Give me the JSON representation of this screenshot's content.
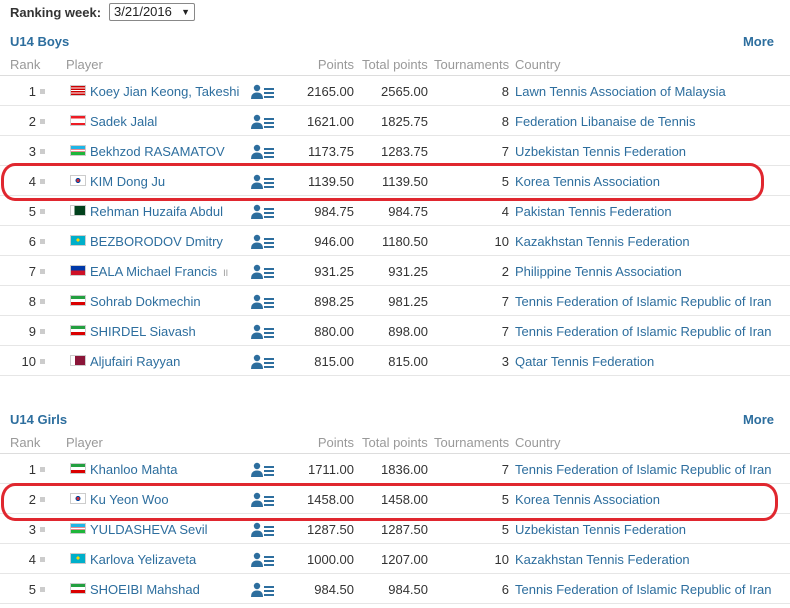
{
  "filter": {
    "label": "Ranking week:",
    "selected": "3/21/2016"
  },
  "headers": {
    "rank": "Rank",
    "player": "Player",
    "points": "Points",
    "total": "Total points",
    "tournaments": "Tournaments",
    "country": "Country"
  },
  "boys": {
    "title": "U14 Boys",
    "more": "More",
    "rows": [
      {
        "rank": "1",
        "flag": "malaysia",
        "player": "Koey Jian Keong, Takeshi",
        "points": "2165.00",
        "total": "2565.00",
        "tournaments": "8",
        "country": "Lawn Tennis Association of Malaysia"
      },
      {
        "rank": "2",
        "flag": "lebanon",
        "player": "Sadek Jalal",
        "points": "1621.00",
        "total": "1825.75",
        "tournaments": "8",
        "country": "Federation Libanaise de Tennis"
      },
      {
        "rank": "3",
        "flag": "uzbekistan",
        "player": "Bekhzod RASAMATOV",
        "points": "1173.75",
        "total": "1283.75",
        "tournaments": "7",
        "country": "Uzbekistan Tennis Federation"
      },
      {
        "rank": "4",
        "flag": "korea",
        "player": "KIM Dong Ju",
        "points": "1139.50",
        "total": "1139.50",
        "tournaments": "5",
        "country": "Korea Tennis Association"
      },
      {
        "rank": "5",
        "flag": "pakistan",
        "player": "Rehman Huzaifa Abdul",
        "points": "984.75",
        "total": "984.75",
        "tournaments": "4",
        "country": "Pakistan Tennis Federation"
      },
      {
        "rank": "6",
        "flag": "kazakhstan",
        "player": "BEZBORODOV Dmitry",
        "points": "946.00",
        "total": "1180.50",
        "tournaments": "10",
        "country": "Kazakhstan Tennis Federation"
      },
      {
        "rank": "7",
        "flag": "philippines",
        "player": "EALA Michael Francis",
        "suffix": "II",
        "points": "931.25",
        "total": "931.25",
        "tournaments": "2",
        "country": "Philippine Tennis Association"
      },
      {
        "rank": "8",
        "flag": "iran",
        "player": "Sohrab Dokmechin",
        "points": "898.25",
        "total": "981.25",
        "tournaments": "7",
        "country": "Tennis Federation of Islamic Republic of Iran"
      },
      {
        "rank": "9",
        "flag": "iran",
        "player": "SHIRDEL Siavash",
        "points": "880.00",
        "total": "898.00",
        "tournaments": "7",
        "country": "Tennis Federation of Islamic Republic of Iran"
      },
      {
        "rank": "10",
        "flag": "qatar",
        "player": "Aljufairi Rayyan",
        "points": "815.00",
        "total": "815.00",
        "tournaments": "3",
        "country": "Qatar Tennis Federation"
      }
    ]
  },
  "girls": {
    "title": "U14 Girls",
    "more": "More",
    "rows": [
      {
        "rank": "1",
        "flag": "iran",
        "player": "Khanloo Mahta",
        "points": "1711.00",
        "total": "1836.00",
        "tournaments": "7",
        "country": "Tennis Federation of Islamic Republic of Iran"
      },
      {
        "rank": "2",
        "flag": "korea",
        "player": "Ku Yeon Woo",
        "points": "1458.00",
        "total": "1458.00",
        "tournaments": "5",
        "country": "Korea Tennis Association"
      },
      {
        "rank": "3",
        "flag": "uzbekistan",
        "player": "YULDASHEVA Sevil",
        "points": "1287.50",
        "total": "1287.50",
        "tournaments": "5",
        "country": "Uzbekistan Tennis Federation"
      },
      {
        "rank": "4",
        "flag": "kazakhstan",
        "player": "Karlova Yelizaveta",
        "points": "1000.00",
        "total": "1207.00",
        "tournaments": "10",
        "country": "Kazakhstan Tennis Federation"
      },
      {
        "rank": "5",
        "flag": "iran",
        "player": "SHOEIBI Mahshad",
        "points": "984.50",
        "total": "984.50",
        "tournaments": "6",
        "country": "Tennis Federation of Islamic Republic of Iran"
      }
    ]
  },
  "highlights": {
    "color": "#e0272f",
    "boys_rank": "4",
    "girls_rank": "2"
  },
  "colors": {
    "link": "#2d6e9e",
    "muted": "#999999"
  },
  "icons": {
    "profile": "player-profile-icon",
    "select_arrow": "chevron-down-icon"
  }
}
